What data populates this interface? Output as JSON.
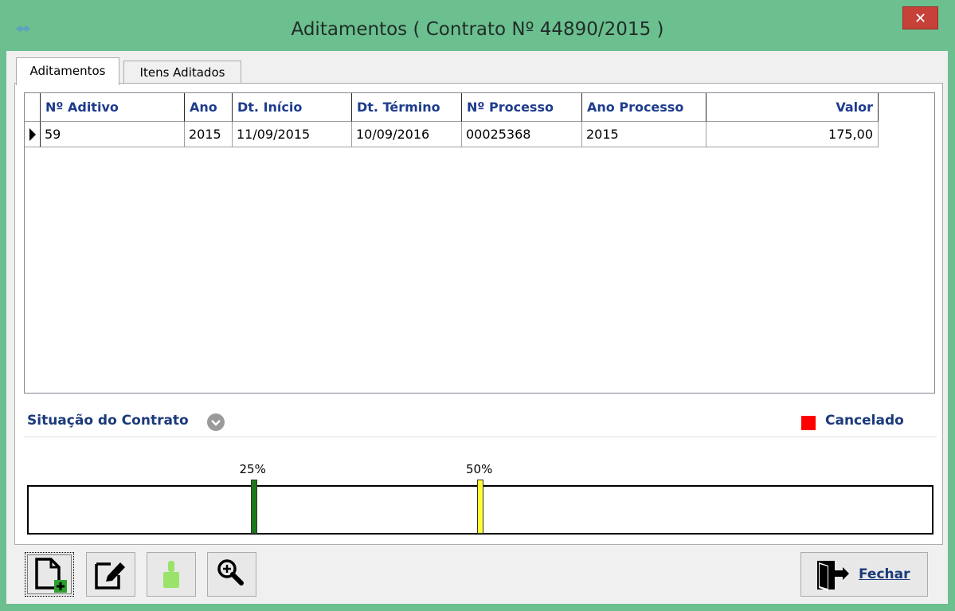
{
  "window": {
    "title": "Aditamentos ( Contrato Nº 44890/2015 )",
    "close_label": "✕"
  },
  "tabs": [
    {
      "label": "Aditamentos",
      "active": true
    },
    {
      "label": "Itens Aditados",
      "active": false
    }
  ],
  "grid": {
    "columns": [
      "Nº Aditivo",
      "Ano",
      "Dt. Início",
      "Dt. Término",
      "Nº Processo",
      "Ano Processo",
      "Valor"
    ],
    "rows": [
      [
        "59",
        "2015",
        "11/09/2015",
        "10/09/2016",
        "00025368",
        "2015",
        "175,00"
      ]
    ]
  },
  "situacao": {
    "title": "Situação do Contrato",
    "status": "Cancelado",
    "status_color": "#ff0000"
  },
  "progress": {
    "markers": [
      {
        "label": "25%",
        "value": 0.25,
        "color": "#1a7a1a"
      },
      {
        "label": "50%",
        "value": 0.5,
        "color": "#ffff33"
      }
    ]
  },
  "toolbar": {
    "buttons": [
      {
        "icon": "new-document-icon"
      },
      {
        "icon": "edit-icon"
      },
      {
        "icon": "clear-brush-icon"
      },
      {
        "icon": "zoom-in-icon"
      }
    ],
    "close_button": {
      "label": "Fechar",
      "icon": "exit-door-icon"
    }
  },
  "colors": {
    "window_frame": "#6cbf8e",
    "header_text": "#1e3c8c",
    "section_text": "#1b3a7a"
  }
}
